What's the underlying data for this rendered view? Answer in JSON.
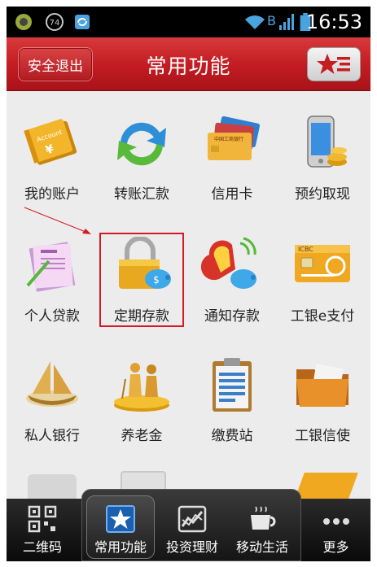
{
  "status_bar": {
    "time": "16:53",
    "badge_number": "74",
    "carrier_letter": "B"
  },
  "header": {
    "logout_label": "安全退出",
    "title": "常用功能"
  },
  "grid": {
    "items": [
      {
        "label": "我的账户",
        "icon": "account-book-icon"
      },
      {
        "label": "转账汇款",
        "icon": "transfer-arrows-icon"
      },
      {
        "label": "信用卡",
        "icon": "credit-cards-icon"
      },
      {
        "label": "预约取现",
        "icon": "phone-cash-icon"
      },
      {
        "label": "个人贷款",
        "icon": "loan-document-icon"
      },
      {
        "label": "定期存款",
        "icon": "lock-piggybank-icon"
      },
      {
        "label": "通知存款",
        "icon": "notify-deposit-icon"
      },
      {
        "label": "工银e支付",
        "icon": "icbc-card-icon"
      },
      {
        "label": "私人银行",
        "icon": "sailboat-icon"
      },
      {
        "label": "养老金",
        "icon": "elderly-couple-icon"
      },
      {
        "label": "缴费站",
        "icon": "clipboard-bill-icon"
      },
      {
        "label": "工银信使",
        "icon": "folder-mail-icon"
      }
    ],
    "icbc_card_text": "ICBC",
    "credit_card_text": "中国工商银行",
    "account_book_text": "Account",
    "piggy_symbol": "$"
  },
  "bottom_nav": {
    "items": [
      {
        "label": "二维码",
        "icon": "qrcode-icon"
      },
      {
        "label": "常用功能",
        "icon": "star-icon",
        "active": true
      },
      {
        "label": "投资理财",
        "icon": "chart-icon"
      },
      {
        "label": "移动生活",
        "icon": "coffee-cup-icon"
      },
      {
        "label": "更多",
        "icon": "more-dots-icon"
      }
    ]
  },
  "colors": {
    "brand_red": "#c41d22",
    "status_blue": "#4aa3df",
    "highlight_red": "#d31c22"
  }
}
